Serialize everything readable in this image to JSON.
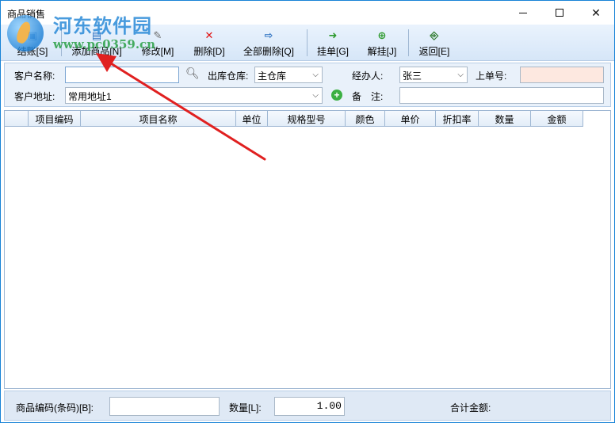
{
  "window": {
    "title": "商品销售"
  },
  "watermark": {
    "brand": "河东软件园",
    "url": "www.pc0359.cn"
  },
  "toolbar": {
    "items": [
      {
        "label": "结账[S]",
        "icon": "checkout-icon"
      },
      {
        "label": "添加商品[N]",
        "icon": "add-item-icon"
      },
      {
        "label": "修改[M]",
        "icon": "edit-icon"
      },
      {
        "label": "删除[D]",
        "icon": "delete-icon"
      },
      {
        "label": "全部删除[Q]",
        "icon": "delete-all-icon"
      },
      {
        "label": "挂单[G]",
        "icon": "hold-order-icon"
      },
      {
        "label": "解挂[J]",
        "icon": "release-order-icon"
      },
      {
        "label": "返回[E]",
        "icon": "exit-icon"
      }
    ]
  },
  "form": {
    "customer_name_label": "客户名称:",
    "customer_name_value": "",
    "warehouse_label": "出库仓库:",
    "warehouse_value": "主仓库",
    "handler_label": "经办人:",
    "handler_value": "张三",
    "last_order_label": "上单号:",
    "last_order_value": "",
    "address_label": "客户地址:",
    "address_value": "常用地址1",
    "remark_label": "备　注:",
    "remark_value": ""
  },
  "grid": {
    "columns": [
      "项目编码",
      "项目名称",
      "单位",
      "规格型号",
      "颜色",
      "单价",
      "折扣率",
      "数量",
      "金额"
    ],
    "rows": []
  },
  "statusbar": {
    "barcode_label": "商品编码(条码)[B]:",
    "barcode_value": "",
    "qty_label": "数量[L]:",
    "qty_value": "1.00",
    "total_label": "合计金额:",
    "total_value": ""
  },
  "colors": {
    "accent": "#1883d7",
    "arrow": "#e02020",
    "toolbar_bg": "#dbe9f9"
  }
}
